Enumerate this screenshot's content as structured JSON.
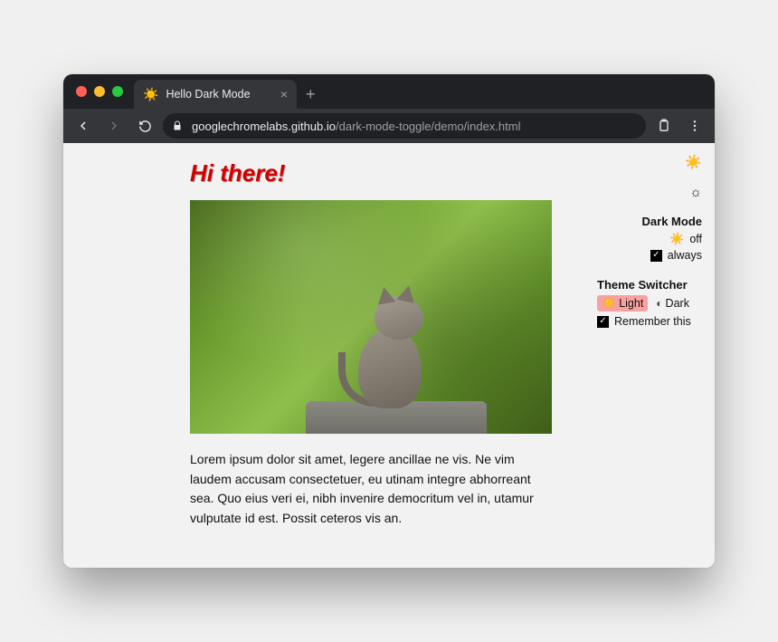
{
  "browser": {
    "tab_title": "Hello Dark Mode",
    "favicon": "sun-icon",
    "url_host": "googlechromelabs.github.io",
    "url_path": "/dark-mode-toggle/demo/index.html"
  },
  "page": {
    "heading": "Hi there!",
    "image_alt": "Grey tabby kitten sitting on a rock in front of green foliage",
    "paragraph": "Lorem ipsum dolor sit amet, legere ancillae ne vis. Ne vim laudem accusam consectetuer, eu utinam integre abhorreant sea. Quo eius veri ei, nibh invenire democritum vel in, utamur vulputate id est. Possit ceteros vis an."
  },
  "sidebar": {
    "dark_mode": {
      "title": "Dark Mode",
      "off_label": "off",
      "always_label": "always",
      "always_checked": true
    },
    "theme_switcher": {
      "title": "Theme Switcher",
      "light_label": "Light",
      "dark_label": "Dark",
      "selected": "light",
      "remember_label": "Remember this",
      "remember_checked": true
    }
  }
}
